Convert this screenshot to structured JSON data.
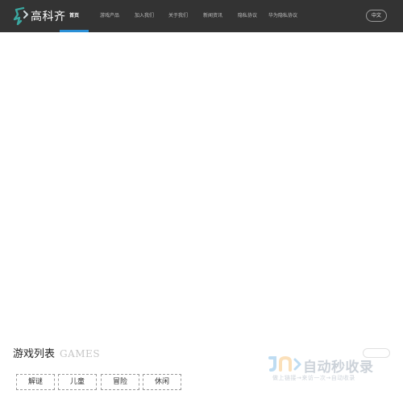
{
  "brand": {
    "name": "高科齐"
  },
  "nav": {
    "items": [
      {
        "label": "首页",
        "active": true
      },
      {
        "label": "游戏产品"
      },
      {
        "label": "加入我们"
      },
      {
        "label": "关于我们"
      },
      {
        "label": "新闻资讯"
      },
      {
        "label": "隐私协议"
      },
      {
        "label": "华为隐私协议"
      }
    ],
    "accent_color": "#2a8fd6"
  },
  "language": {
    "label": "中文"
  },
  "games_section": {
    "title": "游戏列表",
    "title_en": "GAMES",
    "categories": [
      "解谜",
      "儿童",
      "冒险",
      "休闲"
    ]
  },
  "watermark": {
    "main": "自动秒收录",
    "sub": "做上链接→来访一次→自动收录"
  },
  "colors": {
    "topbar": "#333333",
    "background": "#ffffff"
  }
}
